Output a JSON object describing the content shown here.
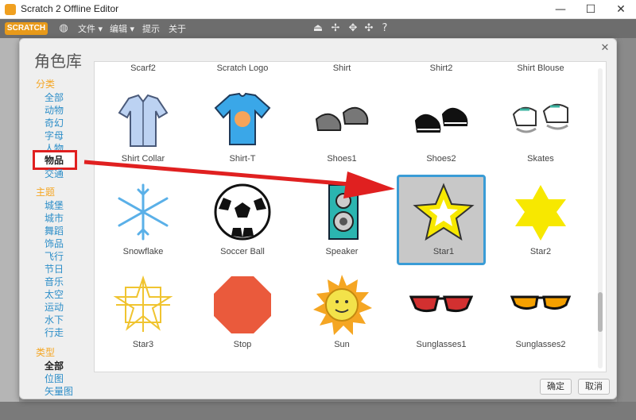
{
  "window": {
    "title": "Scratch 2 Offline Editor",
    "min_icon": "minimize-icon",
    "max_icon": "maximize-icon",
    "close_icon": "close-icon"
  },
  "menubar": {
    "logo": "SCRATCH",
    "items": [
      "文件 ▾",
      "编辑 ▾",
      "提示",
      "关于"
    ]
  },
  "dialog": {
    "title": "角色库",
    "ok_label": "确定",
    "cancel_label": "取消"
  },
  "sidebar": {
    "category_title": "分类",
    "categories": [
      "全部",
      "动物",
      "奇幻",
      "字母",
      "人物",
      "物品",
      "交通"
    ],
    "selected_category": "物品",
    "theme_title": "主题",
    "themes": [
      "城堡",
      "城市",
      "舞蹈",
      "饰品",
      "飞行",
      "节日",
      "音乐",
      "太空",
      "运动",
      "水下",
      "行走"
    ],
    "type_title": "类型",
    "types": [
      "全部",
      "位图",
      "矢量图"
    ]
  },
  "grid": {
    "top_labels": [
      "Scarf2",
      "Scratch Logo",
      "Shirt",
      "Shirt2",
      "Shirt Blouse"
    ],
    "rows": [
      [
        "Shirt Collar",
        "Shirt-T",
        "Shoes1",
        "Shoes2",
        "Skates"
      ],
      [
        "Snowflake",
        "Soccer Ball",
        "Speaker",
        "Star1",
        "Star2"
      ],
      [
        "Star3",
        "Stop",
        "Sun",
        "Sunglasses1",
        "Sunglasses2"
      ]
    ],
    "selected": "Star1"
  },
  "colors": {
    "accent": "#3a9cd6",
    "category": "#f5a623",
    "link": "#2d8ec8",
    "highlight": "#e02020"
  }
}
